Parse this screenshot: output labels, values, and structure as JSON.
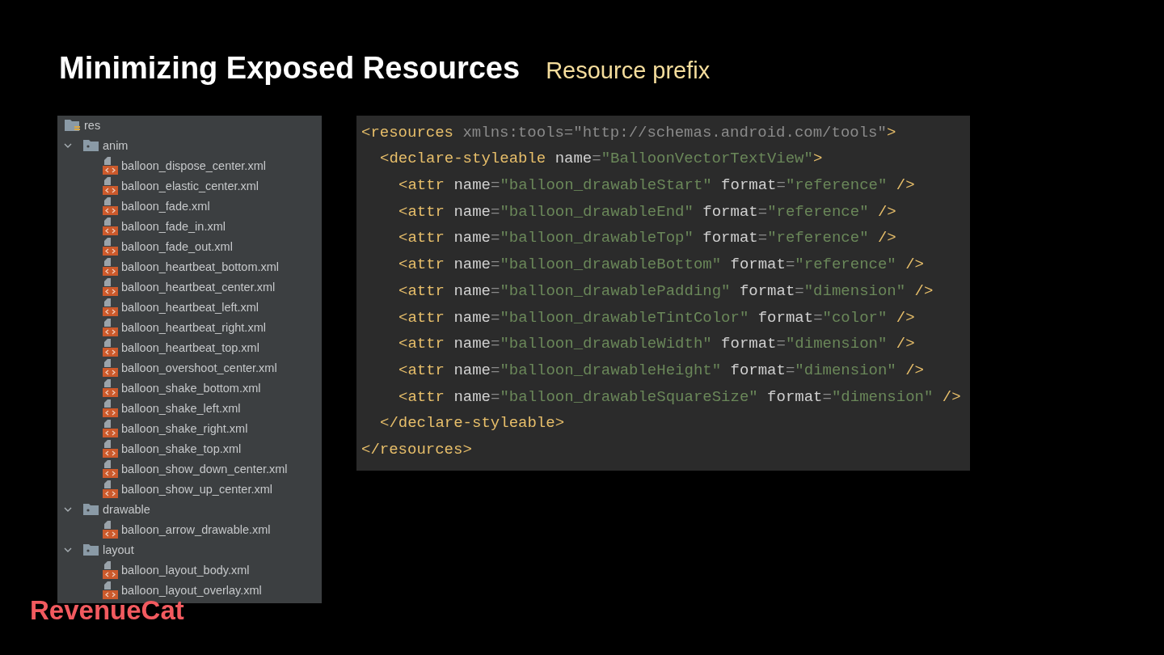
{
  "slide": {
    "title": "Minimizing Exposed Resources",
    "subtitle": "Resource prefix",
    "logo": "RevenueCat"
  },
  "file_tree": {
    "root": {
      "kind": "root",
      "label": "res",
      "children": [
        {
          "kind": "folder",
          "label": "anim",
          "expanded": true,
          "children": [
            {
              "kind": "file",
              "label": "balloon_dispose_center.xml"
            },
            {
              "kind": "file",
              "label": "balloon_elastic_center.xml"
            },
            {
              "kind": "file",
              "label": "balloon_fade.xml"
            },
            {
              "kind": "file",
              "label": "balloon_fade_in.xml"
            },
            {
              "kind": "file",
              "label": "balloon_fade_out.xml"
            },
            {
              "kind": "file",
              "label": "balloon_heartbeat_bottom.xml"
            },
            {
              "kind": "file",
              "label": "balloon_heartbeat_center.xml"
            },
            {
              "kind": "file",
              "label": "balloon_heartbeat_left.xml"
            },
            {
              "kind": "file",
              "label": "balloon_heartbeat_right.xml"
            },
            {
              "kind": "file",
              "label": "balloon_heartbeat_top.xml"
            },
            {
              "kind": "file",
              "label": "balloon_overshoot_center.xml"
            },
            {
              "kind": "file",
              "label": "balloon_shake_bottom.xml"
            },
            {
              "kind": "file",
              "label": "balloon_shake_left.xml"
            },
            {
              "kind": "file",
              "label": "balloon_shake_right.xml"
            },
            {
              "kind": "file",
              "label": "balloon_shake_top.xml"
            },
            {
              "kind": "file",
              "label": "balloon_show_down_center.xml"
            },
            {
              "kind": "file",
              "label": "balloon_show_up_center.xml"
            }
          ]
        },
        {
          "kind": "folder",
          "label": "drawable",
          "expanded": true,
          "children": [
            {
              "kind": "file",
              "label": "balloon_arrow_drawable.xml"
            }
          ]
        },
        {
          "kind": "folder",
          "label": "layout",
          "expanded": true,
          "children": [
            {
              "kind": "file",
              "label": "balloon_layout_body.xml"
            },
            {
              "kind": "file",
              "label": "balloon_layout_overlay.xml"
            }
          ]
        }
      ]
    }
  },
  "code_editor": {
    "element": {
      "open": [
        {
          "kind": "tag",
          "text": "<resources"
        },
        {
          "kind": "dim",
          "text": " xmlns:tools=\"http://schemas.android.com/tools\""
        },
        {
          "kind": "tag",
          "text": ">"
        }
      ],
      "close": [
        {
          "kind": "tag",
          "text": "</resources>"
        }
      ],
      "children": [
        {
          "open": [
            {
              "kind": "tag",
              "text": "<declare-styleable"
            },
            {
              "kind": "attr",
              "text": " name"
            },
            {
              "kind": "dim",
              "text": "="
            },
            {
              "kind": "string",
              "text": "\"BalloonVectorTextView\""
            },
            {
              "kind": "tag",
              "text": ">"
            }
          ],
          "close": [
            {
              "kind": "tag",
              "text": "</declare-styleable>"
            }
          ],
          "children": [
            {
              "open": [
                {
                  "kind": "tag",
                  "text": "<attr"
                },
                {
                  "kind": "attr",
                  "text": " name"
                },
                {
                  "kind": "dim",
                  "text": "="
                },
                {
                  "kind": "string",
                  "text": "\"balloon_drawableStart\""
                },
                {
                  "kind": "attr",
                  "text": " format"
                },
                {
                  "kind": "dim",
                  "text": "="
                },
                {
                  "kind": "string",
                  "text": "\"reference\""
                },
                {
                  "kind": "tag",
                  "text": " />"
                }
              ]
            },
            {
              "open": [
                {
                  "kind": "tag",
                  "text": "<attr"
                },
                {
                  "kind": "attr",
                  "text": " name"
                },
                {
                  "kind": "dim",
                  "text": "="
                },
                {
                  "kind": "string",
                  "text": "\"balloon_drawableEnd\""
                },
                {
                  "kind": "attr",
                  "text": " format"
                },
                {
                  "kind": "dim",
                  "text": "="
                },
                {
                  "kind": "string",
                  "text": "\"reference\""
                },
                {
                  "kind": "tag",
                  "text": " />"
                }
              ]
            },
            {
              "open": [
                {
                  "kind": "tag",
                  "text": "<attr"
                },
                {
                  "kind": "attr",
                  "text": " name"
                },
                {
                  "kind": "dim",
                  "text": "="
                },
                {
                  "kind": "string",
                  "text": "\"balloon_drawableTop\""
                },
                {
                  "kind": "attr",
                  "text": " format"
                },
                {
                  "kind": "dim",
                  "text": "="
                },
                {
                  "kind": "string",
                  "text": "\"reference\""
                },
                {
                  "kind": "tag",
                  "text": " />"
                }
              ]
            },
            {
              "open": [
                {
                  "kind": "tag",
                  "text": "<attr"
                },
                {
                  "kind": "attr",
                  "text": " name"
                },
                {
                  "kind": "dim",
                  "text": "="
                },
                {
                  "kind": "string",
                  "text": "\"balloon_drawableBottom\""
                },
                {
                  "kind": "attr",
                  "text": " format"
                },
                {
                  "kind": "dim",
                  "text": "="
                },
                {
                  "kind": "string",
                  "text": "\"reference\""
                },
                {
                  "kind": "tag",
                  "text": " />"
                }
              ]
            },
            {
              "open": [
                {
                  "kind": "tag",
                  "text": "<attr"
                },
                {
                  "kind": "attr",
                  "text": " name"
                },
                {
                  "kind": "dim",
                  "text": "="
                },
                {
                  "kind": "string",
                  "text": "\"balloon_drawablePadding\""
                },
                {
                  "kind": "attr",
                  "text": " format"
                },
                {
                  "kind": "dim",
                  "text": "="
                },
                {
                  "kind": "string",
                  "text": "\"dimension\""
                },
                {
                  "kind": "tag",
                  "text": " />"
                }
              ]
            },
            {
              "open": [
                {
                  "kind": "tag",
                  "text": "<attr"
                },
                {
                  "kind": "attr",
                  "text": " name"
                },
                {
                  "kind": "dim",
                  "text": "="
                },
                {
                  "kind": "string",
                  "text": "\"balloon_drawableTintColor\""
                },
                {
                  "kind": "attr",
                  "text": " format"
                },
                {
                  "kind": "dim",
                  "text": "="
                },
                {
                  "kind": "string",
                  "text": "\"color\""
                },
                {
                  "kind": "tag",
                  "text": " />"
                }
              ]
            },
            {
              "open": [
                {
                  "kind": "tag",
                  "text": "<attr"
                },
                {
                  "kind": "attr",
                  "text": " name"
                },
                {
                  "kind": "dim",
                  "text": "="
                },
                {
                  "kind": "string",
                  "text": "\"balloon_drawableWidth\""
                },
                {
                  "kind": "attr",
                  "text": " format"
                },
                {
                  "kind": "dim",
                  "text": "="
                },
                {
                  "kind": "string",
                  "text": "\"dimension\""
                },
                {
                  "kind": "tag",
                  "text": " />"
                }
              ]
            },
            {
              "open": [
                {
                  "kind": "tag",
                  "text": "<attr"
                },
                {
                  "kind": "attr",
                  "text": " name"
                },
                {
                  "kind": "dim",
                  "text": "="
                },
                {
                  "kind": "string",
                  "text": "\"balloon_drawableHeight\""
                },
                {
                  "kind": "attr",
                  "text": " format"
                },
                {
                  "kind": "dim",
                  "text": "="
                },
                {
                  "kind": "string",
                  "text": "\"dimension\""
                },
                {
                  "kind": "tag",
                  "text": " />"
                }
              ]
            },
            {
              "open": [
                {
                  "kind": "tag",
                  "text": "<attr"
                },
                {
                  "kind": "attr",
                  "text": " name"
                },
                {
                  "kind": "dim",
                  "text": "="
                },
                {
                  "kind": "string",
                  "text": "\"balloon_drawableSquareSize\""
                },
                {
                  "kind": "attr",
                  "text": " format"
                },
                {
                  "kind": "dim",
                  "text": "="
                },
                {
                  "kind": "string",
                  "text": "\"dimension\""
                },
                {
                  "kind": "tag",
                  "text": " />"
                }
              ]
            }
          ]
        }
      ]
    }
  }
}
